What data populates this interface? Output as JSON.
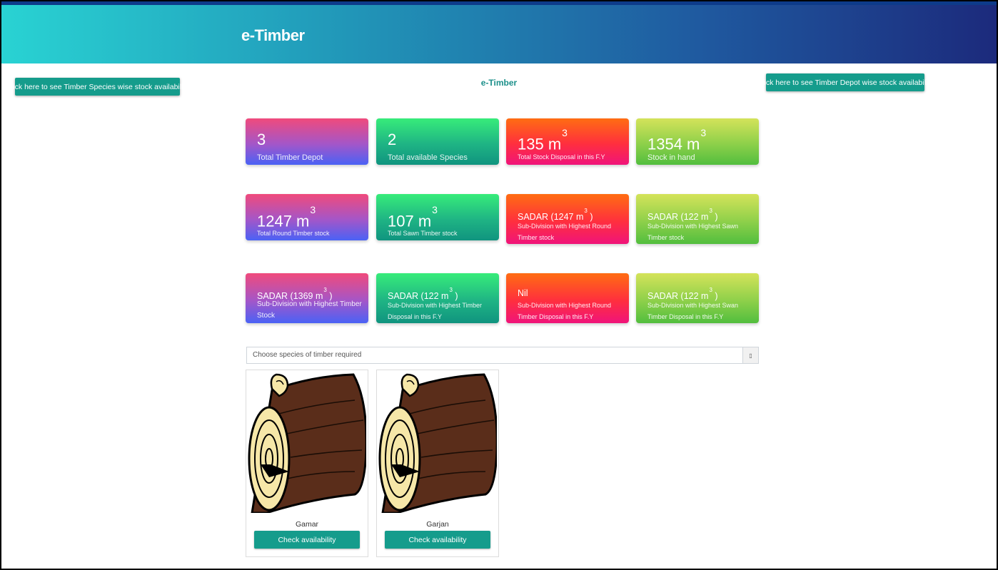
{
  "header": {
    "brand": "e-Timber"
  },
  "page_subtitle": "e-Timber",
  "buttons": {
    "species_stock": "Click here to see Timber Species wise stock availability",
    "depot_stock": "Click here to see Timber Depot wise stock availability"
  },
  "unit": {
    "base": "m",
    "exp": "3"
  },
  "stats_row1": [
    {
      "value": "3",
      "label": "Total Timber Depot"
    },
    {
      "value": "2",
      "label": "Total available Species"
    },
    {
      "value": "135 m",
      "label": "Total Stock Disposal in this F.Y"
    },
    {
      "value": "1354 m",
      "label": "Stock in hand"
    }
  ],
  "stats_row2": [
    {
      "value": "1247 m",
      "label": "Total Round Timber stock"
    },
    {
      "value": "107 m",
      "label": "Total Sawn Timber stock"
    },
    {
      "value": "SADAR (1247 m",
      "suffix": " )",
      "label": "Sub-Division with Highest Round Timber stock"
    },
    {
      "value": "SADAR (122 m",
      "suffix": " )",
      "label": "Sub-Division with Highest Sawn Timber stock"
    }
  ],
  "stats_row3": [
    {
      "value": "SADAR (1369 m",
      "suffix": " )",
      "label": "Sub-Division with Highest Timber Stock"
    },
    {
      "value": "SADAR (122 m",
      "suffix": " )",
      "label": "Sub-Division with Highest Timber Disposal in this F.Y"
    },
    {
      "value": "Nil",
      "label": "Sub-Division with Highest Round Timber Disposal in this F.Y"
    },
    {
      "value": "SADAR (122 m",
      "suffix": " )",
      "label": "Sub-Division with Highest Swan Timber Disposal in this F.Y"
    }
  ],
  "species_select": {
    "placeholder": "Choose species of timber required",
    "button_glyph": "▯"
  },
  "species": [
    {
      "name": "Gamar",
      "button": "Check availability"
    },
    {
      "name": "Garjan",
      "button": "Check availability"
    }
  ],
  "icons": {
    "species_image": "timber-log-icon",
    "dropdown": "dropdown-icon"
  },
  "colors": {
    "accent": "#159c8c",
    "header_start": "#29d3d3",
    "header_end": "#1c2a7c"
  }
}
